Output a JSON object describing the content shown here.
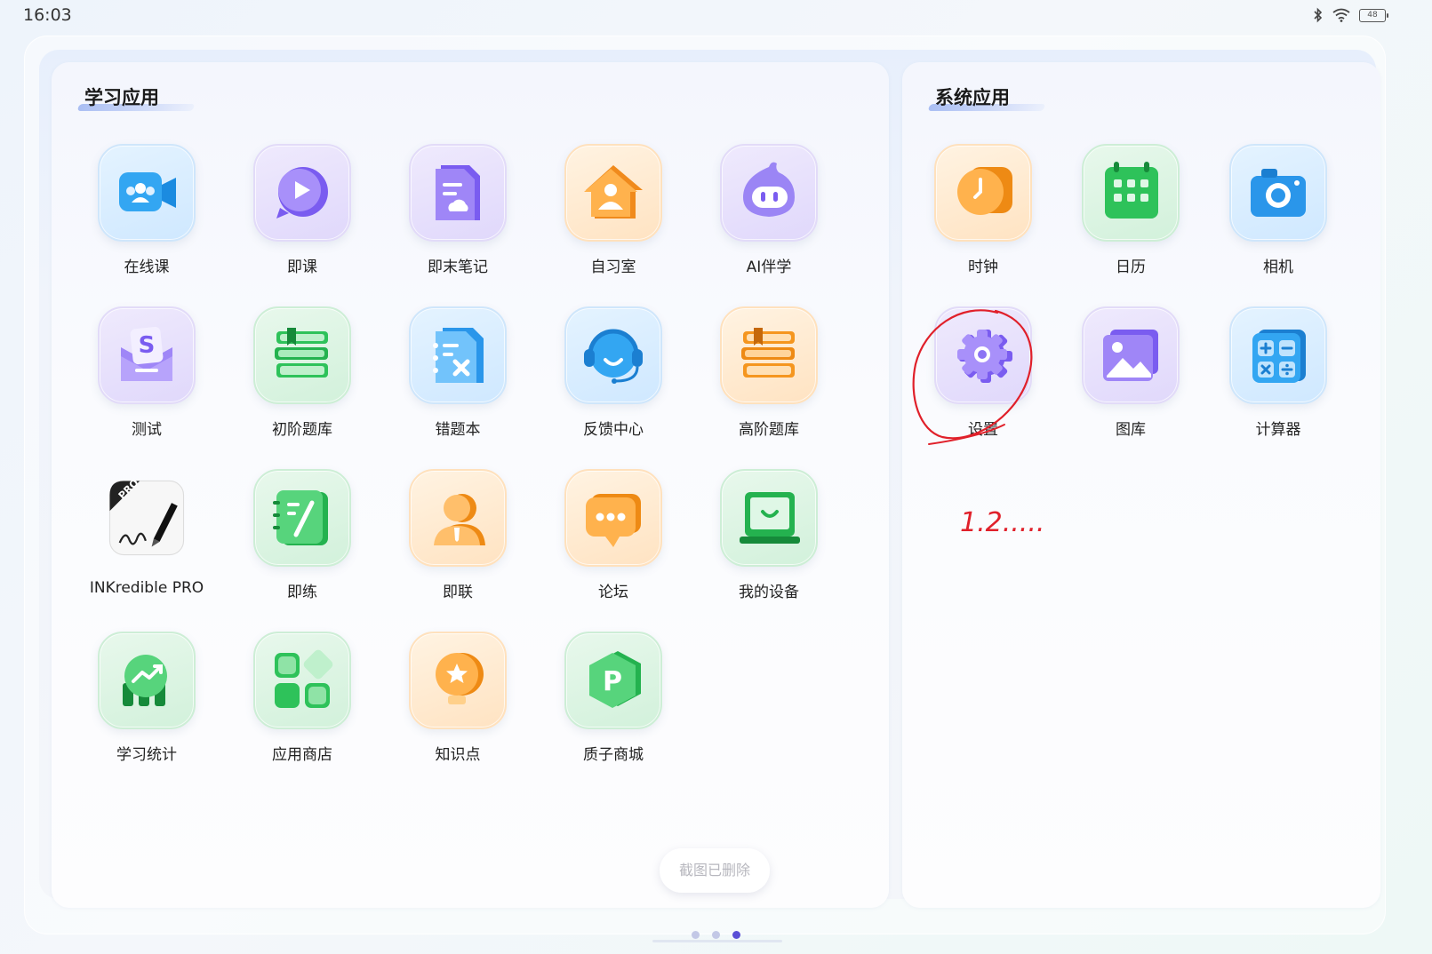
{
  "status_bar": {
    "time": "16:03",
    "battery": "48"
  },
  "study_panel": {
    "title": "学习应用",
    "apps": [
      {
        "label": "在线课",
        "icon": "video-class-icon"
      },
      {
        "label": "即课",
        "icon": "play-icon"
      },
      {
        "label": "即末笔记",
        "icon": "note-icon"
      },
      {
        "label": "自习室",
        "icon": "study-room-icon"
      },
      {
        "label": "AI伴学",
        "icon": "ai-mascot-icon"
      },
      {
        "label": "测试",
        "icon": "test-envelope-icon"
      },
      {
        "label": "初阶题库",
        "icon": "books-green-icon"
      },
      {
        "label": "错题本",
        "icon": "wrong-notebook-icon"
      },
      {
        "label": "反馈中心",
        "icon": "headset-icon"
      },
      {
        "label": "高阶题库",
        "icon": "books-orange-icon"
      },
      {
        "label": "INKredible PRO",
        "icon": "pen-signature-icon"
      },
      {
        "label": "即练",
        "icon": "practice-notebook-icon"
      },
      {
        "label": "即联",
        "icon": "contact-person-icon"
      },
      {
        "label": "论坛",
        "icon": "chat-bubble-icon"
      },
      {
        "label": "我的设备",
        "icon": "device-icon"
      },
      {
        "label": "学习统计",
        "icon": "statistics-icon"
      },
      {
        "label": "应用商店",
        "icon": "app-store-icon"
      },
      {
        "label": "知识点",
        "icon": "lightbulb-icon"
      },
      {
        "label": "质子商城",
        "icon": "p-hexagon-icon"
      }
    ]
  },
  "system_panel": {
    "title": "系统应用",
    "apps": [
      {
        "label": "时钟",
        "icon": "clock-icon"
      },
      {
        "label": "日历",
        "icon": "calendar-icon"
      },
      {
        "label": "相机",
        "icon": "camera-icon"
      },
      {
        "label": "设置",
        "icon": "gear-icon"
      },
      {
        "label": "图库",
        "icon": "gallery-icon"
      },
      {
        "label": "计算器",
        "icon": "calculator-icon"
      }
    ]
  },
  "toast": {
    "text": "截图已删除"
  },
  "pagination": {
    "pages": 3,
    "active_page": 3
  },
  "annotation": {
    "handwritten_text": "1.2.....",
    "circled_app": "设置",
    "color": "#e0202a"
  }
}
